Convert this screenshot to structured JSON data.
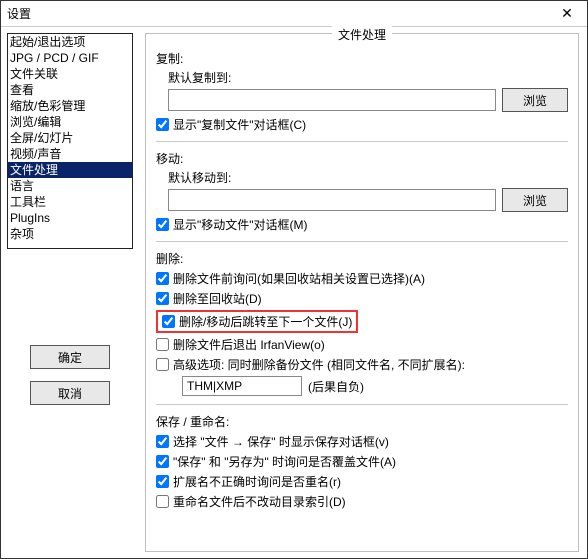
{
  "window_title": "设置",
  "sidebar": {
    "items": [
      "起始/退出选项",
      "JPG / PCD / GIF",
      "文件关联",
      "查看",
      "缩放/色彩管理",
      "浏览/编辑",
      "全屏/幻灯片",
      "视频/声音",
      "文件处理",
      "语言",
      "工具栏",
      "PlugIns",
      "杂项"
    ],
    "selected_index": 8
  },
  "buttons": {
    "ok": "确定",
    "cancel": "取消",
    "browse": "浏览"
  },
  "panel": {
    "legend": "文件处理",
    "copy": {
      "title": "复制:",
      "default_to": "默认复制到:",
      "value": "",
      "show_dialog": "显示\"复制文件\"对话框(C)"
    },
    "move": {
      "title": "移动:",
      "default_to": "默认移动到:",
      "value": "",
      "show_dialog": "显示\"移动文件\"对话框(M)"
    },
    "delete": {
      "title": "删除:",
      "ask_before": "删除文件前询问(如果回收站相关设置已选择)(A)",
      "to_recycle": "删除至回收站(D)",
      "jump_next": "删除/移动后跳转至下一个文件(J)",
      "exit_after": "删除文件后退出 IrfanView(o)",
      "adv_label": "高级选项: 同时删除备份文件 (相同文件名, 不同扩展名):",
      "adv_value": "THM|XMP",
      "adv_tail": "(后果自负)"
    },
    "save": {
      "title": "保存 / 重命名:",
      "show_save_dialog": "选择 \"文件 → 保存\" 时显示保存对话框(v)",
      "ask_overwrite": "\"保存\" 和 \"另存为\" 时询问是否覆盖文件(A)",
      "ask_rename_ext": "扩展名不正确时询问是否重名(r)",
      "no_change_index": "重命名文件后不改动目录索引(D)"
    }
  }
}
